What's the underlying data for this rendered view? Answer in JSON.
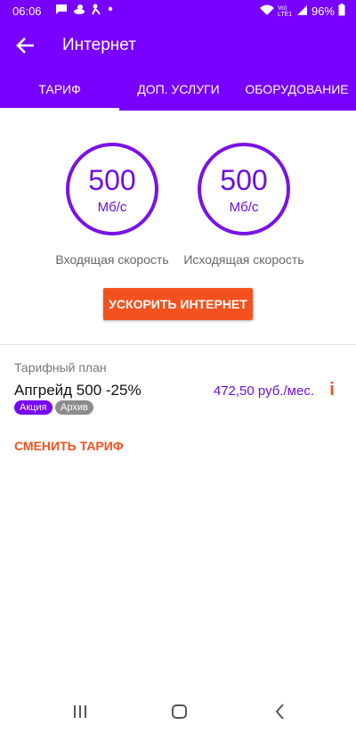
{
  "status": {
    "time": "06:06",
    "battery": "96%",
    "network": "Vo) LTE1",
    "icons": [
      "message-icon",
      "duck-icon",
      "person-icon",
      "dot-icon",
      "wifi-icon",
      "signal-icon",
      "battery-icon"
    ]
  },
  "appbar": {
    "title": "Интернет"
  },
  "tabs": [
    {
      "label": "ТАРИФ",
      "active": true
    },
    {
      "label": "ДОП. УСЛУГИ",
      "active": false
    },
    {
      "label": "ОБОРУДОВАНИЕ",
      "active": false
    }
  ],
  "speeds": {
    "incoming": {
      "value": "500",
      "unit": "Мб/с",
      "label": "Входящая скорость"
    },
    "outgoing": {
      "value": "500",
      "unit": "Мб/с",
      "label": "Исходящая скорость"
    }
  },
  "boost_button": "УСКОРИТЬ ИНТЕРНЕТ",
  "plan": {
    "caption": "Тарифный план",
    "name": "Апгрейд 500 -25%",
    "price": "472,50 руб./мес.",
    "info": "i",
    "badges": [
      "Акция",
      "Архив"
    ]
  },
  "change_tariff": "СМЕНИТЬ ТАРИФ",
  "colors": {
    "primary": "#7700ff",
    "accent": "#f4511e",
    "speed_ring": "#7a12e8",
    "archive_badge": "#8c8c8c"
  }
}
